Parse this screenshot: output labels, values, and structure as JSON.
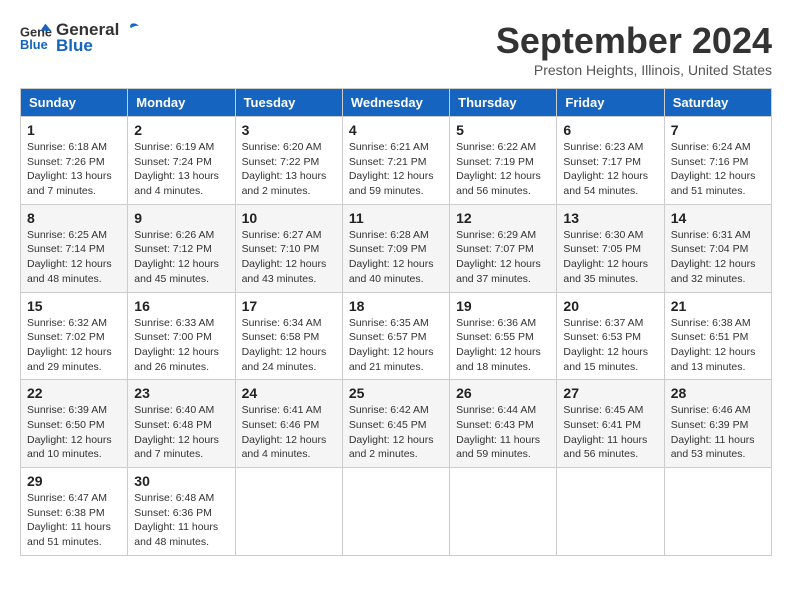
{
  "header": {
    "logo_line1": "General",
    "logo_line2": "Blue",
    "month": "September 2024",
    "location": "Preston Heights, Illinois, United States"
  },
  "weekdays": [
    "Sunday",
    "Monday",
    "Tuesday",
    "Wednesday",
    "Thursday",
    "Friday",
    "Saturday"
  ],
  "weeks": [
    [
      {
        "day": "1",
        "info": "Sunrise: 6:18 AM\nSunset: 7:26 PM\nDaylight: 13 hours\nand 7 minutes."
      },
      {
        "day": "2",
        "info": "Sunrise: 6:19 AM\nSunset: 7:24 PM\nDaylight: 13 hours\nand 4 minutes."
      },
      {
        "day": "3",
        "info": "Sunrise: 6:20 AM\nSunset: 7:22 PM\nDaylight: 13 hours\nand 2 minutes."
      },
      {
        "day": "4",
        "info": "Sunrise: 6:21 AM\nSunset: 7:21 PM\nDaylight: 12 hours\nand 59 minutes."
      },
      {
        "day": "5",
        "info": "Sunrise: 6:22 AM\nSunset: 7:19 PM\nDaylight: 12 hours\nand 56 minutes."
      },
      {
        "day": "6",
        "info": "Sunrise: 6:23 AM\nSunset: 7:17 PM\nDaylight: 12 hours\nand 54 minutes."
      },
      {
        "day": "7",
        "info": "Sunrise: 6:24 AM\nSunset: 7:16 PM\nDaylight: 12 hours\nand 51 minutes."
      }
    ],
    [
      {
        "day": "8",
        "info": "Sunrise: 6:25 AM\nSunset: 7:14 PM\nDaylight: 12 hours\nand 48 minutes."
      },
      {
        "day": "9",
        "info": "Sunrise: 6:26 AM\nSunset: 7:12 PM\nDaylight: 12 hours\nand 45 minutes."
      },
      {
        "day": "10",
        "info": "Sunrise: 6:27 AM\nSunset: 7:10 PM\nDaylight: 12 hours\nand 43 minutes."
      },
      {
        "day": "11",
        "info": "Sunrise: 6:28 AM\nSunset: 7:09 PM\nDaylight: 12 hours\nand 40 minutes."
      },
      {
        "day": "12",
        "info": "Sunrise: 6:29 AM\nSunset: 7:07 PM\nDaylight: 12 hours\nand 37 minutes."
      },
      {
        "day": "13",
        "info": "Sunrise: 6:30 AM\nSunset: 7:05 PM\nDaylight: 12 hours\nand 35 minutes."
      },
      {
        "day": "14",
        "info": "Sunrise: 6:31 AM\nSunset: 7:04 PM\nDaylight: 12 hours\nand 32 minutes."
      }
    ],
    [
      {
        "day": "15",
        "info": "Sunrise: 6:32 AM\nSunset: 7:02 PM\nDaylight: 12 hours\nand 29 minutes."
      },
      {
        "day": "16",
        "info": "Sunrise: 6:33 AM\nSunset: 7:00 PM\nDaylight: 12 hours\nand 26 minutes."
      },
      {
        "day": "17",
        "info": "Sunrise: 6:34 AM\nSunset: 6:58 PM\nDaylight: 12 hours\nand 24 minutes."
      },
      {
        "day": "18",
        "info": "Sunrise: 6:35 AM\nSunset: 6:57 PM\nDaylight: 12 hours\nand 21 minutes."
      },
      {
        "day": "19",
        "info": "Sunrise: 6:36 AM\nSunset: 6:55 PM\nDaylight: 12 hours\nand 18 minutes."
      },
      {
        "day": "20",
        "info": "Sunrise: 6:37 AM\nSunset: 6:53 PM\nDaylight: 12 hours\nand 15 minutes."
      },
      {
        "day": "21",
        "info": "Sunrise: 6:38 AM\nSunset: 6:51 PM\nDaylight: 12 hours\nand 13 minutes."
      }
    ],
    [
      {
        "day": "22",
        "info": "Sunrise: 6:39 AM\nSunset: 6:50 PM\nDaylight: 12 hours\nand 10 minutes."
      },
      {
        "day": "23",
        "info": "Sunrise: 6:40 AM\nSunset: 6:48 PM\nDaylight: 12 hours\nand 7 minutes."
      },
      {
        "day": "24",
        "info": "Sunrise: 6:41 AM\nSunset: 6:46 PM\nDaylight: 12 hours\nand 4 minutes."
      },
      {
        "day": "25",
        "info": "Sunrise: 6:42 AM\nSunset: 6:45 PM\nDaylight: 12 hours\nand 2 minutes."
      },
      {
        "day": "26",
        "info": "Sunrise: 6:44 AM\nSunset: 6:43 PM\nDaylight: 11 hours\nand 59 minutes."
      },
      {
        "day": "27",
        "info": "Sunrise: 6:45 AM\nSunset: 6:41 PM\nDaylight: 11 hours\nand 56 minutes."
      },
      {
        "day": "28",
        "info": "Sunrise: 6:46 AM\nSunset: 6:39 PM\nDaylight: 11 hours\nand 53 minutes."
      }
    ],
    [
      {
        "day": "29",
        "info": "Sunrise: 6:47 AM\nSunset: 6:38 PM\nDaylight: 11 hours\nand 51 minutes."
      },
      {
        "day": "30",
        "info": "Sunrise: 6:48 AM\nSunset: 6:36 PM\nDaylight: 11 hours\nand 48 minutes."
      },
      {
        "day": "",
        "info": ""
      },
      {
        "day": "",
        "info": ""
      },
      {
        "day": "",
        "info": ""
      },
      {
        "day": "",
        "info": ""
      },
      {
        "day": "",
        "info": ""
      }
    ]
  ]
}
